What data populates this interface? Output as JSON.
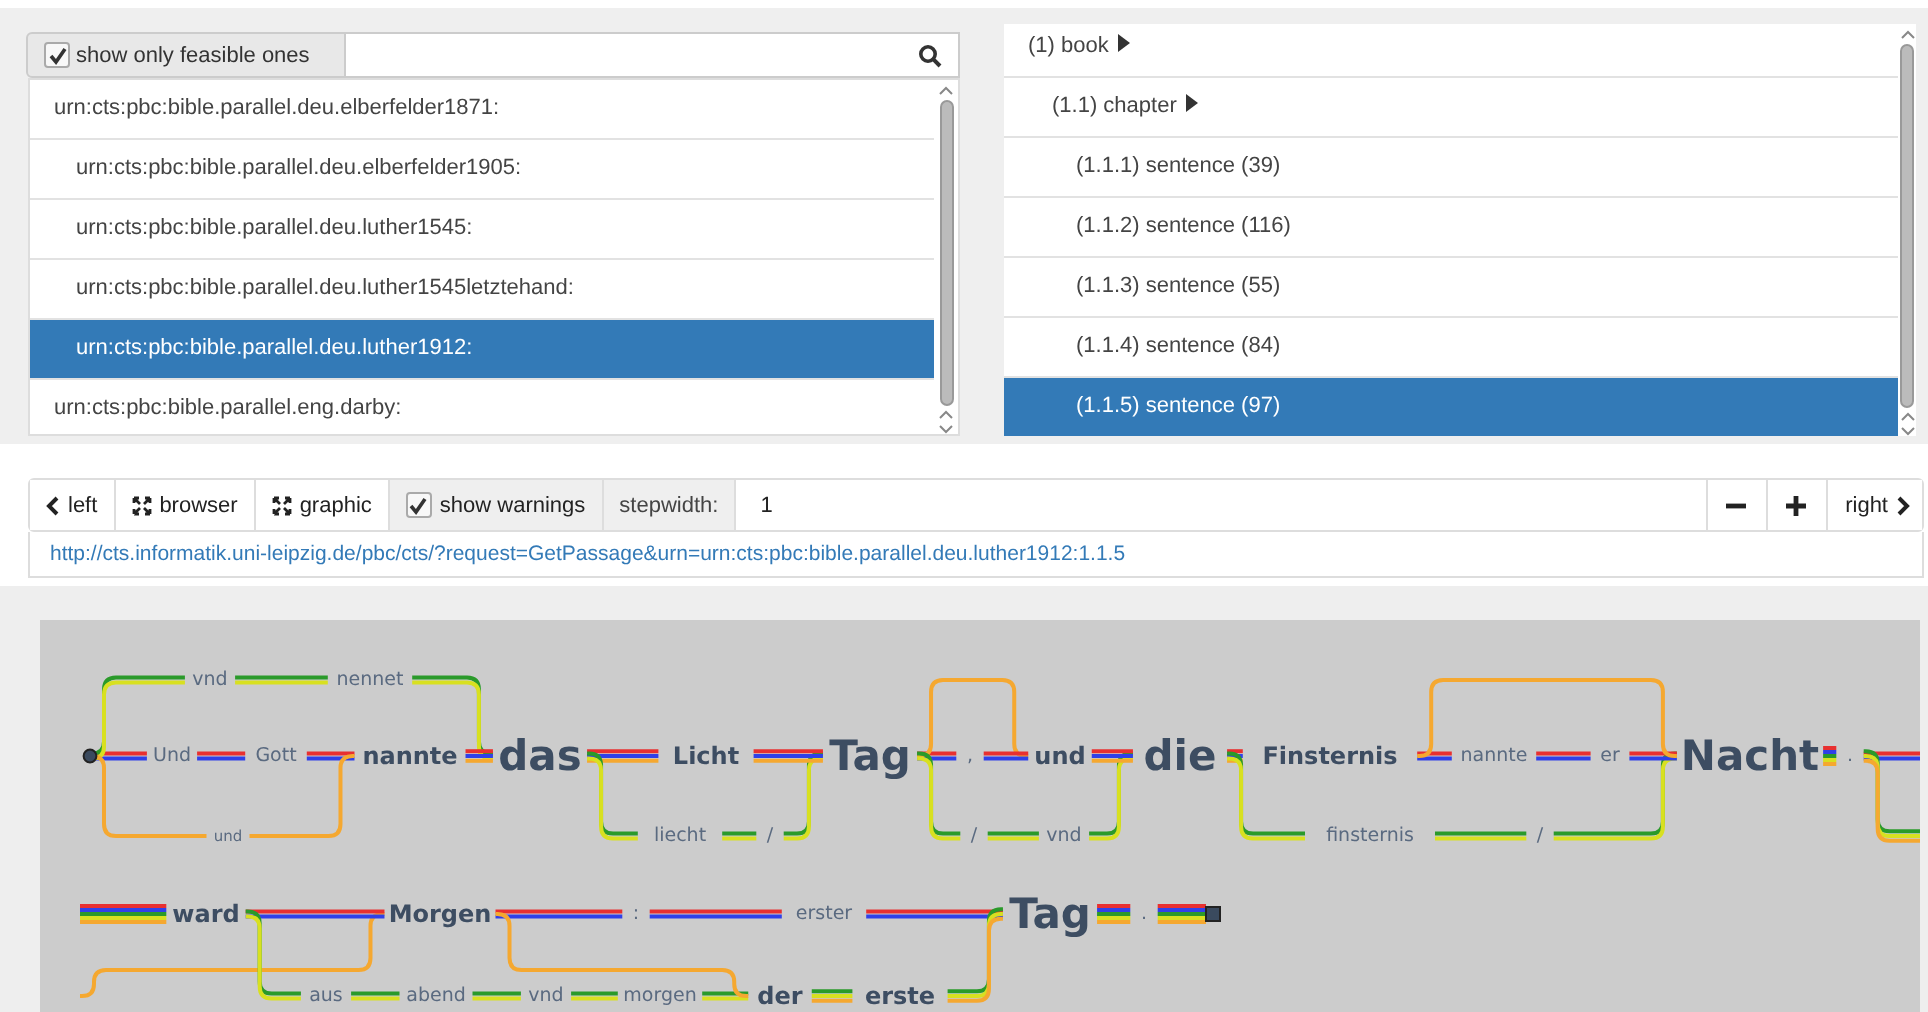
{
  "filter": {
    "label": "show only feasible ones",
    "checked": true
  },
  "left_list": [
    {
      "text": "urn:cts:pbc:bible.parallel.deu.elberfelder1871:",
      "selected": false,
      "children": [
        {
          "text": "urn:cts:pbc:bible.parallel.deu.elberfelder1905:",
          "selected": false
        },
        {
          "text": "urn:cts:pbc:bible.parallel.deu.luther1545:",
          "selected": false
        },
        {
          "text": "urn:cts:pbc:bible.parallel.deu.luther1545letztehand:",
          "selected": false
        },
        {
          "text": "urn:cts:pbc:bible.parallel.deu.luther1912:",
          "selected": true
        }
      ]
    },
    {
      "text": "urn:cts:pbc:bible.parallel.eng.darby:",
      "selected": false
    }
  ],
  "right_tree": [
    {
      "text": "(1) book",
      "selected": false,
      "children": [
        {
          "text": "(1.1) chapter",
          "selected": false,
          "children": [
            {
              "text": "(1.1.1) sentence (39)",
              "selected": false
            },
            {
              "text": "(1.1.2) sentence (116)",
              "selected": false
            },
            {
              "text": "(1.1.3) sentence (55)",
              "selected": false
            },
            {
              "text": "(1.1.4) sentence (84)",
              "selected": false
            },
            {
              "text": "(1.1.5) sentence (97)",
              "selected": true
            }
          ]
        }
      ]
    }
  ],
  "toolbar": {
    "left": "left",
    "browser": "browser",
    "graphic": "graphic",
    "warnings": {
      "label": "show warnings",
      "checked": true
    },
    "stepwidth_label": "stepwidth:",
    "stepwidth_value": "1",
    "right": "right"
  },
  "url": "http://cts.informatik.uni-leipzig.de/pbc/cts/?request=GetPassage&urn=urn:cts:pbc:bible.parallel.deu.luther1912:1.1.5",
  "graph": {
    "words": [
      {
        "text": "vnd",
        "kind": "small"
      },
      {
        "text": "nennet",
        "kind": "small"
      },
      {
        "text": "Und",
        "kind": "small"
      },
      {
        "text": "Gott",
        "kind": "small"
      },
      {
        "text": "und",
        "kind": "tiny"
      },
      {
        "text": "nannte",
        "kind": "medium"
      },
      {
        "text": "das",
        "kind": "large"
      },
      {
        "text": "Licht",
        "kind": "medium"
      },
      {
        "text": "liecht",
        "kind": "small"
      },
      {
        "text": "/",
        "kind": "small"
      },
      {
        "text": "Tag",
        "kind": "large"
      },
      {
        "text": ",",
        "kind": "small"
      },
      {
        "text": "/",
        "kind": "small"
      },
      {
        "text": "und",
        "kind": "medium"
      },
      {
        "text": "vnd",
        "kind": "small"
      },
      {
        "text": "die",
        "kind": "large"
      },
      {
        "text": "Finsternis",
        "kind": "medium"
      },
      {
        "text": "nannte",
        "kind": "small"
      },
      {
        "text": "er",
        "kind": "small"
      },
      {
        "text": "finsternis",
        "kind": "small"
      },
      {
        "text": "/",
        "kind": "small"
      },
      {
        "text": "Nacht",
        "kind": "large"
      },
      {
        "text": ".",
        "kind": "small"
      },
      {
        "text": "ward",
        "kind": "medium"
      },
      {
        "text": "Morgen",
        "kind": "medium"
      },
      {
        "text": ":",
        "kind": "small"
      },
      {
        "text": "erster",
        "kind": "small"
      },
      {
        "text": "Tag",
        "kind": "large"
      },
      {
        "text": ".",
        "kind": "small"
      },
      {
        "text": "aus",
        "kind": "small"
      },
      {
        "text": "abend",
        "kind": "small"
      },
      {
        "text": "vnd",
        "kind": "small"
      },
      {
        "text": "morgen",
        "kind": "small"
      },
      {
        "text": "der",
        "kind": "medium"
      },
      {
        "text": "erste",
        "kind": "medium"
      }
    ]
  }
}
